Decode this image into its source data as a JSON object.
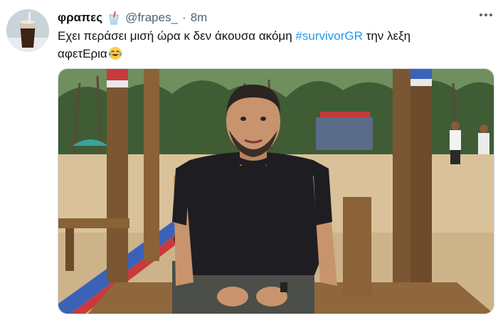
{
  "tweet": {
    "display_name": "φραπες",
    "name_emoji": "cup-with-straw-emoji",
    "handle": "@frapes_",
    "separator": "·",
    "time": "8m",
    "text_before": "Εχει περάσει μισή ώρα κ δεν άκουσα ακόμη ",
    "hashtag": "#survivorGR",
    "text_after_line1": " την λεξη",
    "text_line2": "αφετΕρια",
    "end_emoji": "face-with-tears-of-joy-emoji",
    "more_icon": "more-options-icon"
  },
  "media": {
    "description_icon": "photo",
    "colors": {
      "sky": "#b9d8c0",
      "sand": "#d9c29a",
      "shirt": "#1e1e22",
      "wood": "#7a5632"
    }
  }
}
